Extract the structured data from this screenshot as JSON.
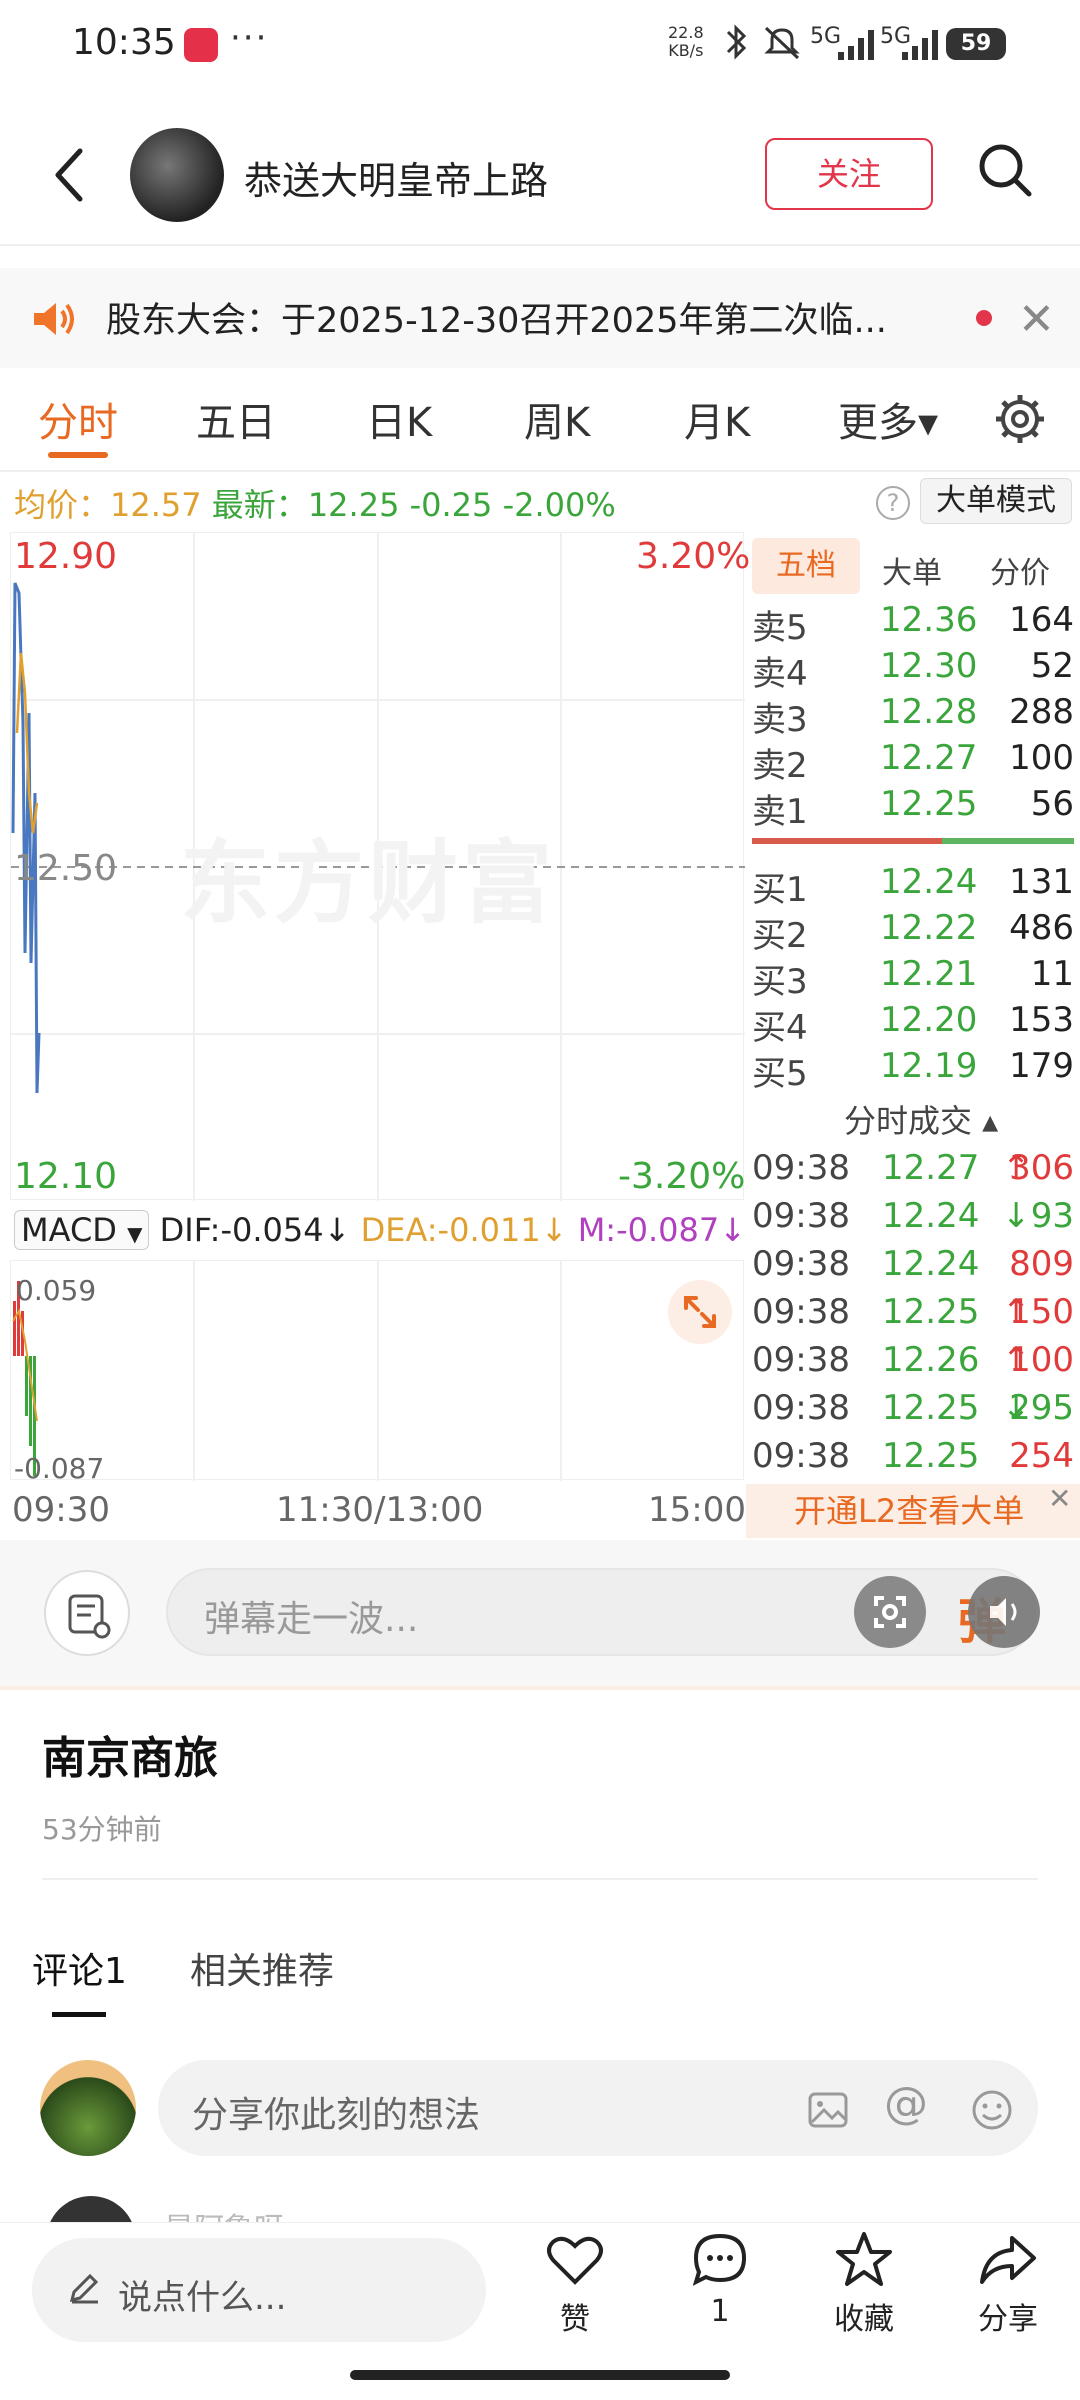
{
  "status_bar": {
    "time": "10:35",
    "more": "···",
    "net_speed_value": "22.8",
    "net_speed_unit": "KB/s",
    "signal1": "5G",
    "signal2": "5G",
    "battery": "59"
  },
  "header": {
    "title": "恭送大明皇帝上路",
    "follow_label": "关注"
  },
  "notice": {
    "text": "股东大会：于2025-12-30召开2025年第二次临..."
  },
  "tabs": [
    "分时",
    "五日",
    "日K",
    "周K",
    "月K",
    "更多▾"
  ],
  "price_line": {
    "avg_label": "均价：",
    "avg_value": "12.57",
    "last_label": "最新：",
    "last_value": "12.25",
    "change": "-0.25",
    "change_pct": "-2.00%",
    "mode_label": "大单模式"
  },
  "chart": {
    "y_top": "12.90",
    "y_mid": "12.50",
    "y_bottom": "12.10",
    "pct_top": "3.20%",
    "pct_bottom": "-3.20%",
    "watermark": "东方财富",
    "x_start": "09:30",
    "x_mid": "11:30/13:00",
    "x_end": "15:00"
  },
  "macd": {
    "selector": "MACD",
    "dif": "DIF:-0.054",
    "dea": "DEA:-0.011",
    "m": "M:-0.087",
    "y_top": "0.059",
    "y_bottom": "-0.087"
  },
  "order_book": {
    "tabs": [
      "五档",
      "大单",
      "分价"
    ],
    "sells": [
      {
        "label": "卖5",
        "price": "12.36",
        "vol": "164"
      },
      {
        "label": "卖4",
        "price": "12.30",
        "vol": "52"
      },
      {
        "label": "卖3",
        "price": "12.28",
        "vol": "288"
      },
      {
        "label": "卖2",
        "price": "12.27",
        "vol": "100"
      },
      {
        "label": "卖1",
        "price": "12.25",
        "vol": "56"
      }
    ],
    "buys": [
      {
        "label": "买1",
        "price": "12.24",
        "vol": "131"
      },
      {
        "label": "买2",
        "price": "12.22",
        "vol": "486"
      },
      {
        "label": "买3",
        "price": "12.21",
        "vol": "11"
      },
      {
        "label": "买4",
        "price": "12.20",
        "vol": "153"
      },
      {
        "label": "买5",
        "price": "12.19",
        "vol": "179"
      }
    ]
  },
  "trades": {
    "title": "分时成交 ▴",
    "rows": [
      {
        "time": "09:38",
        "price": "12.27",
        "arrow": "↑",
        "vol": "306"
      },
      {
        "time": "09:38",
        "price": "12.24",
        "arrow": "↓",
        "vol": "93"
      },
      {
        "time": "09:38",
        "price": "12.24",
        "arrow": "",
        "vol": "809"
      },
      {
        "time": "09:38",
        "price": "12.25",
        "arrow": "↑",
        "vol": "150"
      },
      {
        "time": "09:38",
        "price": "12.26",
        "arrow": "↑",
        "vol": "100"
      },
      {
        "time": "09:38",
        "price": "12.25",
        "arrow": "↓",
        "vol": "295"
      },
      {
        "time": "09:38",
        "price": "12.25",
        "arrow": "",
        "vol": "254"
      }
    ],
    "l2_label": "开通L2查看大单"
  },
  "danmu": {
    "placeholder": "弹幕走一波...",
    "dan": "弹"
  },
  "post": {
    "title": "南京商旅",
    "time": "53分钟前"
  },
  "comments": {
    "tab_comments": "评论1",
    "tab_related": "相关推荐",
    "input_placeholder": "分享你此刻的想法",
    "partial_name": "是阿鲁呀..."
  },
  "bottom_bar": {
    "say_placeholder": "说点什么...",
    "like": "赞",
    "comment_count": "1",
    "collect": "收藏",
    "share": "分享"
  },
  "colors": {
    "accent": "#e86a22",
    "red": "#e03a3a",
    "green": "#3aa53a",
    "follow": "#e3354a"
  }
}
